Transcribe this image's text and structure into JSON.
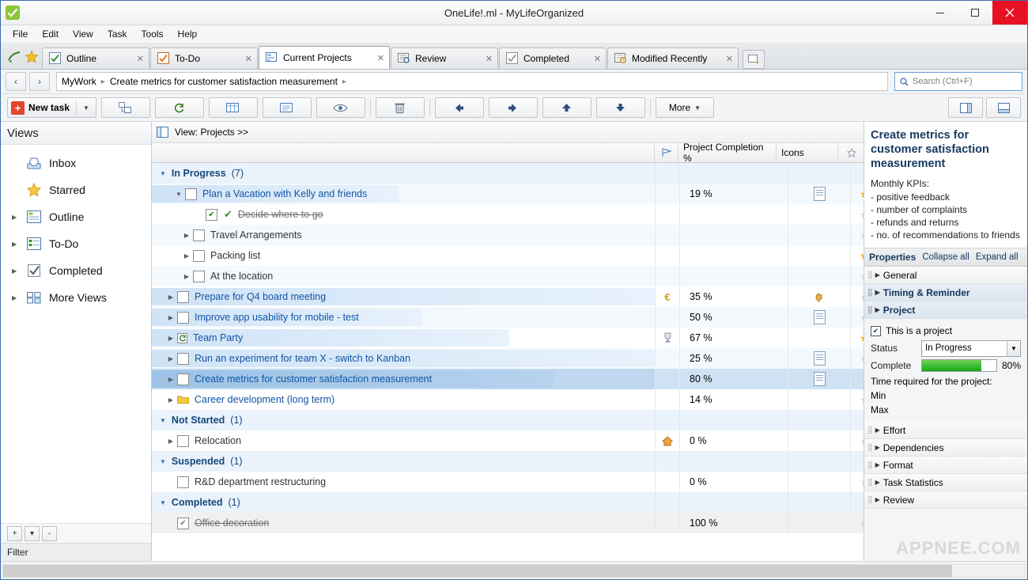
{
  "window": {
    "title": "OneLife!.ml - MyLifeOrganized",
    "app_icon": "mlo-logo-icon",
    "minimize": "–",
    "maximize": "□",
    "close": "✕"
  },
  "menu": [
    "File",
    "Edit",
    "View",
    "Task",
    "Tools",
    "Help"
  ],
  "tabs": [
    {
      "label": "Outline",
      "icon": "checkbox-icon",
      "active": false
    },
    {
      "label": "To-Do",
      "icon": "checklist-icon",
      "active": false
    },
    {
      "label": "Current Projects",
      "icon": "projects-icon",
      "active": true
    },
    {
      "label": "Review",
      "icon": "review-icon",
      "active": false
    },
    {
      "label": "Completed",
      "icon": "completed-icon",
      "active": false
    },
    {
      "label": "Modified Recently",
      "icon": "recent-icon",
      "active": false
    }
  ],
  "breadcrumb": {
    "back": "‹",
    "forward": "›",
    "items": [
      "MyWork",
      "Create metrics for customer satisfaction measurement"
    ],
    "trailing": "▸"
  },
  "search": {
    "placeholder": "Search (Ctrl+F)",
    "icon": "search-icon"
  },
  "toolbar": {
    "new_task": "New task",
    "more": "More",
    "buttons": [
      {
        "name": "add-subtask-button",
        "icon": "add-subtask-icon"
      },
      {
        "name": "refresh-button",
        "icon": "refresh-icon"
      },
      {
        "name": "add-column-button",
        "icon": "table-icon"
      },
      {
        "name": "outline-view-button",
        "icon": "outline-icon"
      },
      {
        "name": "hide-completed-button",
        "icon": "eye-icon"
      },
      {
        "name": "delete-button",
        "icon": "trash-icon"
      },
      {
        "name": "move-left-button",
        "icon": "arrow-left-icon"
      },
      {
        "name": "move-right-button",
        "icon": "arrow-right-icon"
      },
      {
        "name": "move-up-button",
        "icon": "arrow-up-icon"
      },
      {
        "name": "move-down-button",
        "icon": "arrow-down-icon"
      }
    ],
    "right_buttons": [
      {
        "name": "split-horizontal-button",
        "icon": "split-h-icon"
      },
      {
        "name": "split-vertical-button",
        "icon": "split-v-icon"
      }
    ]
  },
  "views": {
    "header": "Views",
    "items": [
      {
        "label": "Inbox",
        "icon": "inbox-icon",
        "expandable": false
      },
      {
        "label": "Starred",
        "icon": "star-icon",
        "expandable": false
      },
      {
        "label": "Outline",
        "icon": "outline-icon",
        "expandable": true
      },
      {
        "label": "To-Do",
        "icon": "todo-icon",
        "expandable": true
      },
      {
        "label": "Completed",
        "icon": "completed-icon",
        "expandable": true
      },
      {
        "label": "More Views",
        "icon": "more-views-icon",
        "expandable": true
      }
    ],
    "footer_buttons": [
      "+",
      "▾",
      "-"
    ],
    "filter_label": "Filter"
  },
  "list": {
    "view_label": "View: Projects >>",
    "columns": [
      {
        "label": "",
        "name": "flag-column"
      },
      {
        "label": "Project Completion %",
        "name": "completion-column"
      },
      {
        "label": "Icons",
        "name": "icons-column"
      },
      {
        "label": "",
        "name": "star-column"
      }
    ],
    "rows": [
      {
        "type": "group",
        "label": "In Progress",
        "count": "(7)"
      },
      {
        "type": "task",
        "indent": 2,
        "label": "Plan a Vacation with Kelly and friends",
        "pct": "19 %",
        "bar": 100,
        "checkbox": true,
        "twisty": "▾",
        "star": "on",
        "icon": "note-icon",
        "flag": ""
      },
      {
        "type": "task",
        "indent": 4,
        "label": "Decide where to go",
        "pct": "",
        "bar": 0,
        "checkbox": "checked",
        "twisty": "",
        "star": "off",
        "icon": "",
        "flag": "",
        "done": true,
        "check2": "✔"
      },
      {
        "type": "task",
        "indent": 3,
        "label": "Travel Arrangements",
        "pct": "",
        "bar": 0,
        "checkbox": true,
        "twisty": "▸",
        "star": "off",
        "icon": "",
        "flag": "",
        "plain": true
      },
      {
        "type": "task",
        "indent": 3,
        "label": "Packing list",
        "pct": "",
        "bar": 0,
        "checkbox": true,
        "twisty": "▸",
        "star": "on",
        "icon": "",
        "flag": "",
        "plain": true
      },
      {
        "type": "task",
        "indent": 3,
        "label": "At the location",
        "pct": "",
        "bar": 0,
        "checkbox": true,
        "twisty": "▸",
        "star": "off",
        "icon": "",
        "flag": "",
        "plain": true
      },
      {
        "type": "task",
        "indent": 2,
        "label": "Prepare for Q4 board meeting",
        "pct": "35 %",
        "bar": 100,
        "checkbox": true,
        "twisty": "▸",
        "star": "off",
        "icon": "hand-icon",
        "flag": "euro-icon"
      },
      {
        "type": "task",
        "indent": 2,
        "label": "Improve app usability for mobile - test",
        "pct": "50 %",
        "bar": 54,
        "checkbox": true,
        "twisty": "▸",
        "star": "off",
        "icon": "note-icon",
        "flag": ""
      },
      {
        "type": "task",
        "indent": 2,
        "label": "Team Party",
        "pct": "67 %",
        "bar": 71,
        "checkbox": "recurring",
        "twisty": "▸",
        "star": "on",
        "icon": "",
        "flag": "trophy-icon"
      },
      {
        "type": "task",
        "indent": 2,
        "label": "Run an experiment for team X - switch to Kanban",
        "pct": "25 %",
        "bar": 100,
        "checkbox": true,
        "twisty": "▸",
        "star": "off",
        "icon": "note-icon",
        "flag": ""
      },
      {
        "type": "task",
        "indent": 2,
        "label": "Create metrics for customer satisfaction measurement",
        "pct": "80 %",
        "bar": 100,
        "checkbox": true,
        "twisty": "▸",
        "star": "off",
        "icon": "note-icon",
        "flag": "",
        "selected": true
      },
      {
        "type": "task",
        "indent": 2,
        "label": "Career development (long term)",
        "pct": "14 %",
        "bar": 0,
        "checkbox": "folder",
        "twisty": "▸",
        "star": "off",
        "icon": "",
        "flag": ""
      },
      {
        "type": "group",
        "label": "Not Started",
        "count": "(1)"
      },
      {
        "type": "task",
        "indent": 2,
        "label": "Relocation",
        "pct": "0 %",
        "bar": 0,
        "checkbox": true,
        "twisty": "▸",
        "star": "off",
        "icon": "",
        "flag": "home-icon",
        "plain": true
      },
      {
        "type": "group",
        "label": "Suspended",
        "count": "(1)"
      },
      {
        "type": "task",
        "indent": 2,
        "label": "R&D department restructuring",
        "pct": "0 %",
        "bar": 0,
        "checkbox": true,
        "twisty": "",
        "star": "off",
        "icon": "",
        "flag": "",
        "plain": true
      },
      {
        "type": "group",
        "label": "Completed",
        "count": "(1)"
      },
      {
        "type": "task",
        "indent": 2,
        "label": "Office decoration",
        "pct": "100 %",
        "bar": 0,
        "checkbox": "checked",
        "twisty": "",
        "star": "off",
        "icon": "",
        "flag": "",
        "done": true
      }
    ]
  },
  "properties": {
    "task_title": "Create metrics for customer satisfaction measurement",
    "note": "Monthly KPIs:\n- positive feedback\n- number of complaints\n- refunds and returns\n- no. of recommendations to friends",
    "header": "Properties",
    "collapse_all": "Collapse all",
    "expand_all": "Expand all",
    "groups": [
      {
        "label": "General",
        "open": false,
        "bold": false
      },
      {
        "label": "Timing & Reminder",
        "open": false,
        "bold": true
      },
      {
        "label": "Project",
        "open": true,
        "bold": true
      },
      {
        "label": "Effort",
        "open": false,
        "bold": false
      },
      {
        "label": "Dependencies",
        "open": false,
        "bold": false
      },
      {
        "label": "Format",
        "open": false,
        "bold": false
      },
      {
        "label": "Task Statistics",
        "open": false,
        "bold": false
      },
      {
        "label": "Review",
        "open": false,
        "bold": false
      }
    ],
    "project": {
      "is_project_label": "This is a project",
      "is_project_checked": true,
      "status_label": "Status",
      "status_value": "In Progress",
      "complete_label": "Complete",
      "complete_pct": "80%",
      "complete_value": 80,
      "time_required_label": "Time required for the project:",
      "min_label": "Min",
      "max_label": "Max"
    }
  },
  "watermark": "APPNEE.COM"
}
